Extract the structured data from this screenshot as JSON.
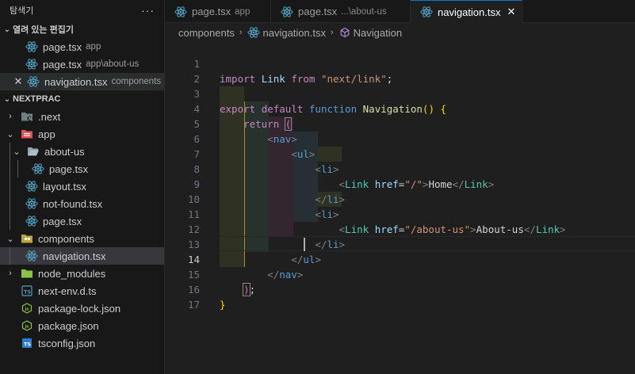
{
  "sidebar": {
    "title": "탐색기",
    "more": "···",
    "open_editors": {
      "title": "열려 있는 편집기",
      "items": [
        {
          "name": "page.tsx",
          "desc": "app"
        },
        {
          "name": "page.tsx",
          "desc": "app\\about-us"
        },
        {
          "name": "navigation.tsx",
          "desc": "components"
        }
      ]
    },
    "project": {
      "title": "NEXTPRAC",
      "tree": [
        {
          "label": ".next"
        },
        {
          "label": "app"
        },
        {
          "label": "about-us"
        },
        {
          "label": "page.tsx"
        },
        {
          "label": "layout.tsx"
        },
        {
          "label": "not-found.tsx"
        },
        {
          "label": "page.tsx"
        },
        {
          "label": "components"
        },
        {
          "label": "navigation.tsx"
        },
        {
          "label": "node_modules"
        },
        {
          "label": "next-env.d.ts"
        },
        {
          "label": "package-lock.json"
        },
        {
          "label": "package.json"
        },
        {
          "label": "tsconfig.json"
        }
      ]
    }
  },
  "tabs": [
    {
      "name": "page.tsx",
      "desc": "app"
    },
    {
      "name": "page.tsx",
      "desc": "...\\about-us"
    },
    {
      "name": "navigation.tsx",
      "desc": ""
    }
  ],
  "breadcrumb": [
    "components",
    "navigation.tsx",
    "Navigation"
  ],
  "editor": {
    "line_numbers": [
      "1",
      "2",
      "3",
      "4",
      "5",
      "6",
      "7",
      "8",
      "9",
      "10",
      "11",
      "12",
      "13",
      "14",
      "15",
      "16",
      "17"
    ],
    "current_line": "14",
    "tokens": {
      "l1": [
        "import",
        "Link",
        "from",
        "\"next/link\"",
        ";"
      ],
      "l3": [
        "export",
        "default",
        "function",
        "Navigation",
        "(",
        ")",
        "{"
      ],
      "l4": [
        "return",
        "("
      ],
      "l5": [
        "<",
        "nav",
        ">"
      ],
      "l6": [
        "<",
        "ul",
        ">"
      ],
      "l7": [
        "<",
        "li",
        ">"
      ],
      "l8": [
        "<",
        "Link",
        "href",
        "=",
        "\"/\"",
        ">",
        "Home",
        "</",
        "Link",
        ">"
      ],
      "l9": [
        "</",
        "li",
        ">"
      ],
      "l10": [
        "<",
        "li",
        ">"
      ],
      "l11": [
        "<",
        "Link",
        "href",
        "=",
        "\"/about-us\"",
        ">",
        "About-us",
        "</",
        "Link",
        ">"
      ],
      "l12": [
        "</",
        "li",
        ">"
      ],
      "l13": [
        "</",
        "ul",
        ">"
      ],
      "l14": [
        "</",
        "nav",
        ">"
      ],
      "l15": [
        ")",
        ";"
      ],
      "l16": [
        "}"
      ]
    }
  },
  "colors": {
    "accent": "#0078d4",
    "react_icon": "#519aba",
    "keyword": "#569cd6",
    "control": "#c586c0",
    "type": "#4ec9b0",
    "string": "#ce9178",
    "function": "#dcdcaa",
    "attribute": "#9cdcfe"
  }
}
